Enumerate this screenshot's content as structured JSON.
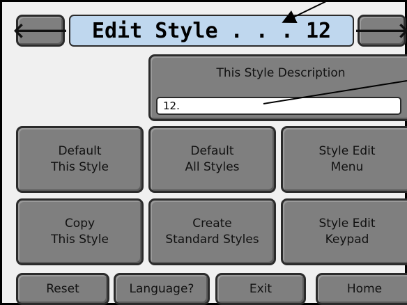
{
  "header": {
    "back_icon": "left-arrow-icon",
    "forward_icon": "right-arrow-icon",
    "back_glyph": "🡐",
    "forward_glyph": "🡒",
    "title": "Edit Style . . . 12"
  },
  "description": {
    "label": "This Style Description",
    "value": "12."
  },
  "grid": {
    "default_this_style": "Default\nThis Style",
    "default_all_styles": "Default\nAll Styles",
    "style_edit_menu": "Style Edit\nMenu",
    "copy_this_style": "Copy\nThis Style",
    "create_standard_styles": "Create\nStandard Styles",
    "style_edit_keypad": "Style Edit\nKeypad"
  },
  "footer": {
    "reset": "Reset",
    "language": "Language?",
    "exit": "Exit",
    "home": "Home"
  },
  "colors": {
    "button": "#7f7f7f",
    "title_bar": "#bfd7ee",
    "screen_bg": "#f0f0f0"
  }
}
